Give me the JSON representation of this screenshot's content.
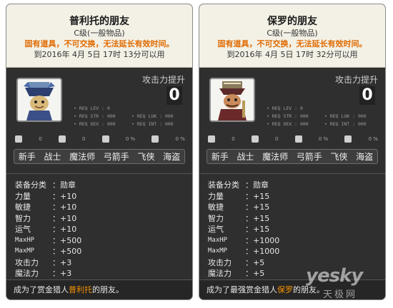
{
  "cards": [
    {
      "name": "普利托的朋友",
      "grade": "C级(一般物品)",
      "warning": "固有道具，不可交换，无法延长有效时间。",
      "expiry": "到2016年 4月 5日 17时 13分可以用",
      "attack_label": "攻击力提升",
      "attack_value": "0",
      "req_lev": "• REQ LEV : 0",
      "req_str": "• REQ STR : 000",
      "req_luk": "• REQ LUK : 000",
      "req_dex": "• REQ DEX : 000",
      "req_int": "• REQ INT : 000",
      "icon_dots": [
        "0",
        "0",
        "0 %",
        "0 %"
      ],
      "jobs": [
        "新手",
        "战士",
        "魔法师",
        "弓箭手",
        "飞侠",
        "海盗"
      ],
      "stats": [
        {
          "k": "装备分类",
          "v": "：勋章"
        },
        {
          "k": "力量",
          "v": "：+10"
        },
        {
          "k": "敏捷",
          "v": "：+10"
        },
        {
          "k": "智力",
          "v": "：+10"
        },
        {
          "k": "运气",
          "v": "：+10"
        },
        {
          "k": "MaxHP",
          "v": "：+500"
        },
        {
          "k": "MaxMP",
          "v": "：+500"
        },
        {
          "k": "攻击力",
          "v": "：+3"
        },
        {
          "k": "魔法力",
          "v": "：+3"
        }
      ],
      "footer_pre": "成为了赏金猎人",
      "footer_hl": "普利托",
      "footer_post": "的朋友。"
    },
    {
      "name": "保罗的朋友",
      "grade": "C级(一般物品)",
      "warning": "固有道具，不可交换，无法延长有效时间。",
      "expiry": "到2016年 4月 5日 17时 32分可以用",
      "attack_label": "攻击力提升",
      "attack_value": "0",
      "req_lev": "• REQ LEV : 0",
      "req_str": "• REQ STR : 000",
      "req_luk": "• REQ LUK : 000",
      "req_dex": "• REQ DEX : 000",
      "req_int": "• REQ INT : 000",
      "icon_dots": [
        "0",
        "0",
        "0 %",
        "0 %"
      ],
      "jobs": [
        "新手",
        "战士",
        "魔法师",
        "弓箭手",
        "飞侠",
        "海盗"
      ],
      "stats": [
        {
          "k": "装备分类",
          "v": "：勋章"
        },
        {
          "k": "力量",
          "v": "：+15"
        },
        {
          "k": "敏捷",
          "v": "：+15"
        },
        {
          "k": "智力",
          "v": "：+15"
        },
        {
          "k": "运气",
          "v": "：+15"
        },
        {
          "k": "MaxHP",
          "v": "：+1000"
        },
        {
          "k": "MaxMP",
          "v": "：+1000"
        },
        {
          "k": "攻击力",
          "v": "：+5"
        },
        {
          "k": "魔法力",
          "v": "：+5"
        }
      ],
      "footer_pre": "成为了最强赏金猎人",
      "footer_hl": "保罗",
      "footer_post": "的朋友。"
    }
  ],
  "watermark": {
    "brand": "yesky",
    "sub": "天极网"
  },
  "colors": {
    "panel": "#2f2f2f",
    "header": "#f3f1e6",
    "warning": "#e06a00",
    "highlight": "#f29100"
  }
}
